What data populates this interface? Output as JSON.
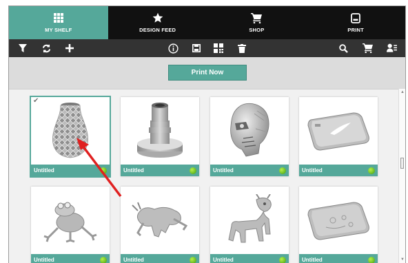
{
  "nav": {
    "tabs": [
      {
        "label": "MY SHELF",
        "icon": "grid-icon"
      },
      {
        "label": "DESIGN FEED",
        "icon": "star-icon"
      },
      {
        "label": "SHOP",
        "icon": "cart-icon"
      },
      {
        "label": "PRINT",
        "icon": "printer-icon"
      }
    ]
  },
  "toolbar": {
    "left_icons": [
      "filter-icon",
      "refresh-icon",
      "add-icon"
    ],
    "center_icons": [
      "info-icon",
      "save-icon",
      "qr-icon",
      "trash-icon"
    ],
    "right_icons": [
      "search-icon",
      "cart-icon",
      "user-menu-icon"
    ]
  },
  "actions": {
    "print_now_label": "Print Now"
  },
  "shelf": {
    "items": [
      {
        "title": "Untitled",
        "model": "vase",
        "selected": true
      },
      {
        "title": "Untitled",
        "model": "spool"
      },
      {
        "title": "Untitled",
        "model": "robot-head"
      },
      {
        "title": "Untitled",
        "model": "phone-case"
      },
      {
        "title": "Untitled",
        "model": "frog"
      },
      {
        "title": "Untitled",
        "model": "bull"
      },
      {
        "title": "Untitled",
        "model": "dog"
      },
      {
        "title": "Untitled",
        "model": "phone-case-2"
      }
    ]
  },
  "colors": {
    "accent": "#55a89a",
    "nav_bg": "#111111",
    "toolbar_bg": "#333333",
    "status_ok": "#5cc61e",
    "arrow": "#e02020"
  }
}
